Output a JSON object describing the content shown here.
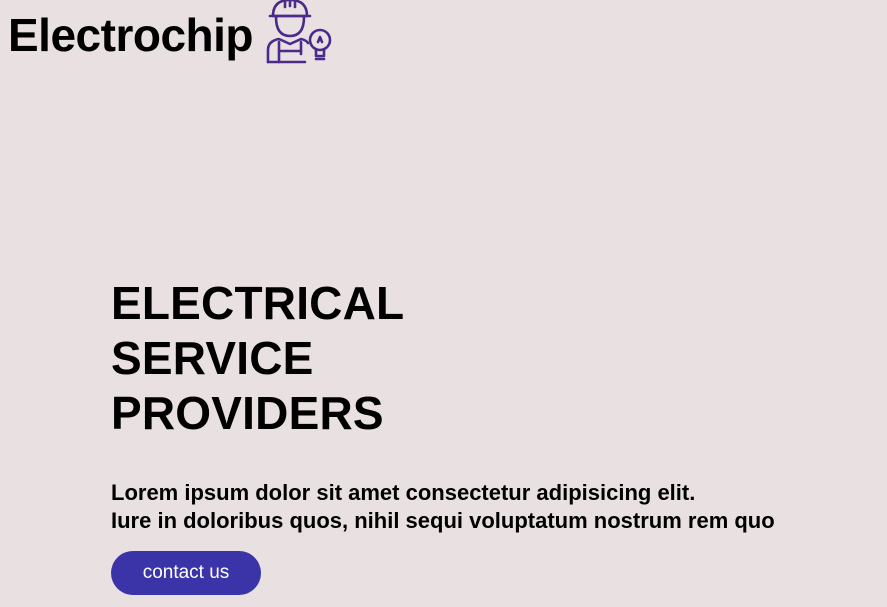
{
  "header": {
    "brand_name": "Electrochip",
    "brand_icon": "electrician-with-lightbulb-icon",
    "icon_color": "#4b2a8c"
  },
  "hero": {
    "title_lines": [
      "ELECTRICAL",
      "SERVICE",
      "PROVIDERS"
    ],
    "text_lines": [
      "Lorem ipsum dolor sit amet consectetur adipisicing elit.",
      "Iure in doloribus quos, nihil sequi voluptatum nostrum rem quo"
    ],
    "cta_label": "contact us",
    "cta_color": "#3b34a8"
  },
  "colors": {
    "background": "#e8e0e1"
  }
}
